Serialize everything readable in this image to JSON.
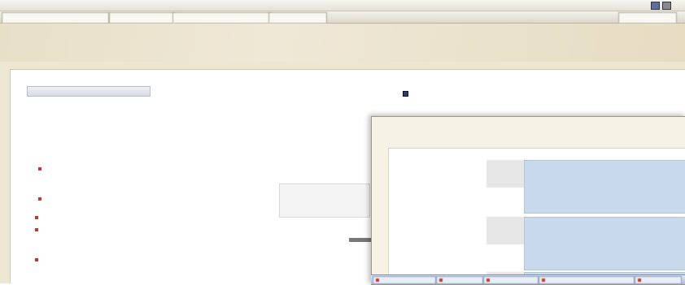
{
  "colors": {
    "window_background": "#ede6d2",
    "title_text": "#6a5a36",
    "panel_background": "#ffffff",
    "highlight_blue": "#c9d9ec",
    "accent_red": "#c0392b"
  },
  "top_bar": {
    "text": "",
    "icon": "window-icon"
  },
  "tab_bar": {
    "tabs": [
      "",
      "",
      "",
      "",
      ""
    ]
  },
  "app": {
    "title": ""
  },
  "panel": {
    "header": ""
  },
  "tree": {
    "header": "",
    "close_label": "",
    "items": [
      "",
      "",
      "",
      "",
      "",
      "",
      "",
      "",
      "",
      "",
      "",
      "",
      "",
      "",
      "",
      "",
      "",
      "",
      "",
      "",
      "",
      "",
      "",
      "",
      "",
      "",
      "",
      "",
      ""
    ]
  },
  "content": {
    "top_right_label": "",
    "line_1": "",
    "line_2": "",
    "line_3": "",
    "line_4": "",
    "line_5": "",
    "line_6": "",
    "line_7": "",
    "line_8": ""
  },
  "form": {
    "line_1": "",
    "line_2": ""
  },
  "dialog": {
    "title": "",
    "sidebar": [
      "",
      "",
      "",
      ""
    ],
    "rows": [
      {
        "label": "",
        "lines": [
          "",
          "",
          "",
          "",
          "",
          ""
        ]
      },
      {
        "label": "",
        "lines": [
          "",
          "",
          "",
          "",
          "",
          ""
        ]
      },
      {
        "label": "",
        "lines": [
          ""
        ]
      }
    ]
  },
  "taskbar": {
    "items": [
      "",
      "",
      "",
      "",
      ""
    ]
  }
}
